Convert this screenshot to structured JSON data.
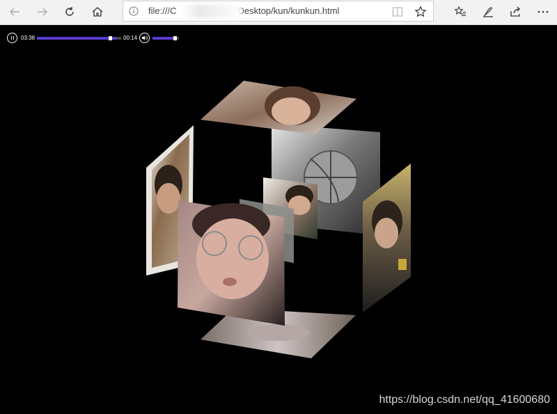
{
  "browser": {
    "url": "file:///C:/Users/Desktop/kun/kunkun.html",
    "url_visible_start": "file:///C",
    "url_visible_end": "Desktop/kun/kunkun.html",
    "icons": [
      "back-icon",
      "forward-icon",
      "refresh-icon",
      "home-icon",
      "info-icon",
      "reading-view-icon",
      "favorite-star-icon",
      "favorites-list-icon",
      "pen-icon",
      "share-icon",
      "more-icon"
    ]
  },
  "player": {
    "elapsed": "03:38",
    "remaining": "00:14",
    "progress": 0.94,
    "volume": 0.85
  },
  "cube": {
    "faces": [
      "top-photo",
      "left-photo",
      "right-photo",
      "bottom-photo",
      "back-photo",
      "inner-photo",
      "front-photo"
    ]
  },
  "watermark": "https://blog.csdn.net/qq_41600680"
}
